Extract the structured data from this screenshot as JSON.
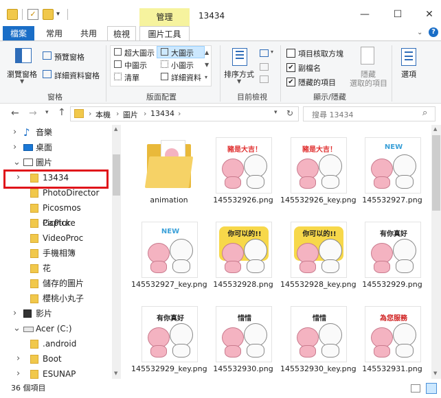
{
  "window": {
    "context_tab_group": "管理",
    "title": "13434",
    "minimize": "—",
    "maximize": "☐",
    "close": "✕"
  },
  "tabs": {
    "file": "檔案",
    "home": "常用",
    "share": "共用",
    "view": "檢視",
    "picture_tools": "圖片工具"
  },
  "ribbon": {
    "panes": {
      "navigation_pane": "瀏覽窗格",
      "preview_pane": "預覽窗格",
      "details_pane": "詳細資料窗格",
      "group_label": "窗格"
    },
    "layout": {
      "extra_large_icons": "超大圖示",
      "large_icons": "大圖示",
      "medium_icons": "中圖示",
      "small_icons": "小圖示",
      "list": "清單",
      "details": "詳細資料",
      "group_label": "版面配置"
    },
    "current_view": {
      "sort_by": "排序方式",
      "group_label": "目前檢視"
    },
    "show_hide": {
      "item_checkboxes": "項目核取方塊",
      "file_name_extensions": "副檔名",
      "hidden_items": "隱藏的項目",
      "hide_selected_line1": "隱藏",
      "hide_selected_line2": "選取的項目",
      "group_label": "顯示/隱藏",
      "item_checkboxes_checked": false,
      "file_name_extensions_checked": true,
      "hidden_items_checked": true
    },
    "options": "選項"
  },
  "address": {
    "crumbs": [
      "本機",
      "圖片",
      "13434"
    ],
    "search_placeholder": "搜尋 13434"
  },
  "nav": [
    {
      "label": "音樂",
      "chevron": ">",
      "icon": "music-icon"
    },
    {
      "label": "桌面",
      "chevron": ">",
      "icon": "desktop-icon"
    },
    {
      "label": "圖片",
      "chevron": "v",
      "icon": "pictures-icon"
    },
    {
      "label": "13434",
      "chevron": ">",
      "icon": "folder-icon"
    },
    {
      "label": "PhotoDirector",
      "chevron": "",
      "icon": "folder-icon"
    },
    {
      "label": "Picosmos Capture",
      "chevron": "",
      "icon": "folder-icon"
    },
    {
      "label": "PicPick",
      "chevron": "",
      "icon": "folder-icon"
    },
    {
      "label": "VideoProc",
      "chevron": "",
      "icon": "folder-icon"
    },
    {
      "label": "手機相簿",
      "chevron": "",
      "icon": "folder-icon"
    },
    {
      "label": "花",
      "chevron": "",
      "icon": "folder-icon"
    },
    {
      "label": "儲存的圖片",
      "chevron": "",
      "icon": "folder-icon"
    },
    {
      "label": "櫻桃小丸子",
      "chevron": "",
      "icon": "folder-icon"
    },
    {
      "label": "影片",
      "chevron": ">",
      "icon": "video-icon"
    },
    {
      "label": "Acer (C:)",
      "chevron": "v",
      "icon": "drive-icon"
    },
    {
      "label": ".android",
      "chevron": "",
      "icon": "folder-icon"
    },
    {
      "label": "Boot",
      "chevron": ">",
      "icon": "folder-icon"
    },
    {
      "label": "ESUNAP",
      "chevron": ">",
      "icon": "folder-icon"
    }
  ],
  "files": [
    {
      "name": "animation",
      "kind": "folder"
    },
    {
      "name": "145532926.png",
      "kind": "sticker",
      "banner": "豬是大吉！",
      "banner_color": "#e03030"
    },
    {
      "name": "145532926_key.png",
      "kind": "sticker",
      "banner": "豬是大吉！",
      "banner_color": "#e03030"
    },
    {
      "name": "145532927.png",
      "kind": "sticker",
      "banner": "NEW",
      "banner_color": "#3aa0d8"
    },
    {
      "name": "145532927_key.png",
      "kind": "sticker",
      "banner": "NEW",
      "banner_color": "#3aa0d8"
    },
    {
      "name": "145532928.png",
      "kind": "sticker",
      "banner": "你可以的!!",
      "banner_color": "#222222"
    },
    {
      "name": "145532928_key.png",
      "kind": "sticker",
      "banner": "你可以的!!",
      "banner_color": "#222222"
    },
    {
      "name": "145532929.png",
      "kind": "sticker",
      "banner": "有你真好",
      "banner_color": "#222222"
    },
    {
      "name": "145532929_key.png",
      "kind": "sticker",
      "banner": "有你真好",
      "banner_color": "#222222"
    },
    {
      "name": "145532930.png",
      "kind": "sticker",
      "banner": "惜惜",
      "banner_color": "#222222"
    },
    {
      "name": "145532930_key.png",
      "kind": "sticker",
      "banner": "惜惜",
      "banner_color": "#222222"
    },
    {
      "name": "145532931.png",
      "kind": "sticker",
      "banner": "為您服務",
      "banner_color": "#d02020"
    }
  ],
  "status": {
    "count": "36 個項目"
  },
  "colors": {
    "accent": "#1a6ec7",
    "selection": "#cce8ff",
    "highlight_box": "#e0131a",
    "context_tab": "#f6f39e"
  }
}
